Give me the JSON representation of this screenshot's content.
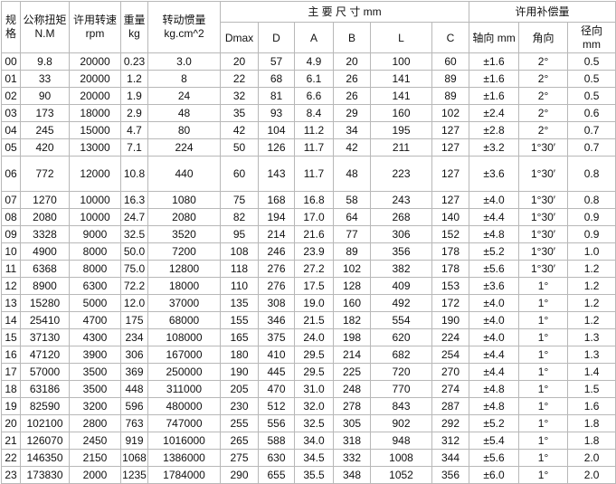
{
  "headers": {
    "model_l1": "规",
    "model_l2": "格",
    "torque_l1": "公称扭矩",
    "torque_l2": "N.M",
    "speed_l1": "许用转速",
    "speed_l2": "rpm",
    "weight_l1": "重量",
    "weight_l2": "kg",
    "inertia_l1": "转动惯量",
    "inertia_l2": "kg.cm^2",
    "dims_group": "主 要 尺 寸 mm",
    "comp_group": "许用补偿量",
    "dmax": "Dmax",
    "d": "D",
    "a": "A",
    "b": "B",
    "l": "L",
    "c": "C",
    "axial": "轴向 mm",
    "angular": "角向",
    "radial_l1": "径向",
    "radial_l2": "mm"
  },
  "rows": [
    {
      "id": "00",
      "torque": "9.8",
      "speed": "20000",
      "weight": "0.23",
      "inertia": "3.0",
      "dmax": "20",
      "d": "57",
      "a": "4.9",
      "b": "20",
      "l": "100",
      "c": "60",
      "axial": "±1.6",
      "angular": "2°",
      "radial": "0.5"
    },
    {
      "id": "01",
      "torque": "33",
      "speed": "20000",
      "weight": "1.2",
      "inertia": "8",
      "dmax": "22",
      "d": "68",
      "a": "6.1",
      "b": "26",
      "l": "141",
      "c": "89",
      "axial": "±1.6",
      "angular": "2°",
      "radial": "0.5"
    },
    {
      "id": "02",
      "torque": "90",
      "speed": "20000",
      "weight": "1.9",
      "inertia": "24",
      "dmax": "32",
      "d": "81",
      "a": "6.6",
      "b": "26",
      "l": "141",
      "c": "89",
      "axial": "±1.6",
      "angular": "2°",
      "radial": "0.5"
    },
    {
      "id": "03",
      "torque": "173",
      "speed": "18000",
      "weight": "2.9",
      "inertia": "48",
      "dmax": "35",
      "d": "93",
      "a": "8.4",
      "b": "29",
      "l": "160",
      "c": "102",
      "axial": "±2.4",
      "angular": "2°",
      "radial": "0.6"
    },
    {
      "id": "04",
      "torque": "245",
      "speed": "15000",
      "weight": "4.7",
      "inertia": "80",
      "dmax": "42",
      "d": "104",
      "a": "11.2",
      "b": "34",
      "l": "195",
      "c": "127",
      "axial": "±2.8",
      "angular": "2°",
      "radial": "0.7"
    },
    {
      "id": "05",
      "torque": "420",
      "speed": "13000",
      "weight": "7.1",
      "inertia": "224",
      "dmax": "50",
      "d": "126",
      "a": "11.7",
      "b": "42",
      "l": "211",
      "c": "127",
      "axial": "±3.2",
      "angular": "1°30′",
      "radial": "0.7"
    },
    {
      "id": "06",
      "torque": "772",
      "speed": "12000",
      "weight": "10.8",
      "inertia": "440",
      "dmax": "60",
      "d": "143",
      "a": "11.7",
      "b": "48",
      "l": "223",
      "c": "127",
      "axial": "±3.6",
      "angular": "1°30′",
      "radial": "0.8"
    },
    {
      "id": "07",
      "torque": "1270",
      "speed": "10000",
      "weight": "16.3",
      "inertia": "1080",
      "dmax": "75",
      "d": "168",
      "a": "16.8",
      "b": "58",
      "l": "243",
      "c": "127",
      "axial": "±4.0",
      "angular": "1°30′",
      "radial": "0.8"
    },
    {
      "id": "08",
      "torque": "2080",
      "speed": "10000",
      "weight": "24.7",
      "inertia": "2080",
      "dmax": "82",
      "d": "194",
      "a": "17.0",
      "b": "64",
      "l": "268",
      "c": "140",
      "axial": "±4.4",
      "angular": "1°30′",
      "radial": "0.9"
    },
    {
      "id": "09",
      "torque": "3328",
      "speed": "9000",
      "weight": "32.5",
      "inertia": "3520",
      "dmax": "95",
      "d": "214",
      "a": "21.6",
      "b": "77",
      "l": "306",
      "c": "152",
      "axial": "±4.8",
      "angular": "1°30′",
      "radial": "0.9"
    },
    {
      "id": "10",
      "torque": "4900",
      "speed": "8000",
      "weight": "50.0",
      "inertia": "7200",
      "dmax": "108",
      "d": "246",
      "a": "23.9",
      "b": "89",
      "l": "356",
      "c": "178",
      "axial": "±5.2",
      "angular": "1°30′",
      "radial": "1.0"
    },
    {
      "id": "11",
      "torque": "6368",
      "speed": "8000",
      "weight": "75.0",
      "inertia": "12800",
      "dmax": "118",
      "d": "276",
      "a": "27.2",
      "b": "102",
      "l": "382",
      "c": "178",
      "axial": "±5.6",
      "angular": "1°30′",
      "radial": "1.2"
    },
    {
      "id": "12",
      "torque": "8900",
      "speed": "6300",
      "weight": "72.2",
      "inertia": "18000",
      "dmax": "110",
      "d": "276",
      "a": "17.5",
      "b": "128",
      "l": "409",
      "c": "153",
      "axial": "±3.6",
      "angular": "1°",
      "radial": "1.2"
    },
    {
      "id": "13",
      "torque": "15280",
      "speed": "5000",
      "weight": "12.0",
      "inertia": "37000",
      "dmax": "135",
      "d": "308",
      "a": "19.0",
      "b": "160",
      "l": "492",
      "c": "172",
      "axial": "±4.0",
      "angular": "1°",
      "radial": "1.2"
    },
    {
      "id": "14",
      "torque": "25410",
      "speed": "4700",
      "weight": "175",
      "inertia": "68000",
      "dmax": "155",
      "d": "346",
      "a": "21.5",
      "b": "182",
      "l": "554",
      "c": "190",
      "axial": "±4.0",
      "angular": "1°",
      "radial": "1.2"
    },
    {
      "id": "15",
      "torque": "37130",
      "speed": "4300",
      "weight": "234",
      "inertia": "108000",
      "dmax": "165",
      "d": "375",
      "a": "24.0",
      "b": "198",
      "l": "620",
      "c": "224",
      "axial": "±4.0",
      "angular": "1°",
      "radial": "1.3"
    },
    {
      "id": "16",
      "torque": "47120",
      "speed": "3900",
      "weight": "306",
      "inertia": "167000",
      "dmax": "180",
      "d": "410",
      "a": "29.5",
      "b": "214",
      "l": "682",
      "c": "254",
      "axial": "±4.4",
      "angular": "1°",
      "radial": "1.3"
    },
    {
      "id": "17",
      "torque": "57000",
      "speed": "3500",
      "weight": "369",
      "inertia": "250000",
      "dmax": "190",
      "d": "445",
      "a": "29.5",
      "b": "225",
      "l": "720",
      "c": "270",
      "axial": "±4.4",
      "angular": "1°",
      "radial": "1.4"
    },
    {
      "id": "18",
      "torque": "63186",
      "speed": "3500",
      "weight": "448",
      "inertia": "311000",
      "dmax": "205",
      "d": "470",
      "a": "31.0",
      "b": "248",
      "l": "770",
      "c": "274",
      "axial": "±4.8",
      "angular": "1°",
      "radial": "1.5"
    },
    {
      "id": "19",
      "torque": "82590",
      "speed": "3200",
      "weight": "596",
      "inertia": "480000",
      "dmax": "230",
      "d": "512",
      "a": "32.0",
      "b": "278",
      "l": "843",
      "c": "287",
      "axial": "±4.8",
      "angular": "1°",
      "radial": "1.6"
    },
    {
      "id": "20",
      "torque": "102100",
      "speed": "2800",
      "weight": "763",
      "inertia": "747000",
      "dmax": "255",
      "d": "556",
      "a": "32.5",
      "b": "305",
      "l": "902",
      "c": "292",
      "axial": "±5.2",
      "angular": "1°",
      "radial": "1.8"
    },
    {
      "id": "21",
      "torque": "126070",
      "speed": "2450",
      "weight": "919",
      "inertia": "1016000",
      "dmax": "265",
      "d": "588",
      "a": "34.0",
      "b": "318",
      "l": "948",
      "c": "312",
      "axial": "±5.4",
      "angular": "1°",
      "radial": "1.8"
    },
    {
      "id": "22",
      "torque": "146350",
      "speed": "2150",
      "weight": "1068",
      "inertia": "1386000",
      "dmax": "275",
      "d": "630",
      "a": "34.5",
      "b": "332",
      "l": "1008",
      "c": "344",
      "axial": "±5.6",
      "angular": "1°",
      "radial": "2.0"
    },
    {
      "id": "23",
      "torque": "173830",
      "speed": "2000",
      "weight": "1235",
      "inertia": "1784000",
      "dmax": "290",
      "d": "655",
      "a": "35.5",
      "b": "348",
      "l": "1052",
      "c": "356",
      "axial": "±6.0",
      "angular": "1°",
      "radial": "2.0"
    }
  ]
}
